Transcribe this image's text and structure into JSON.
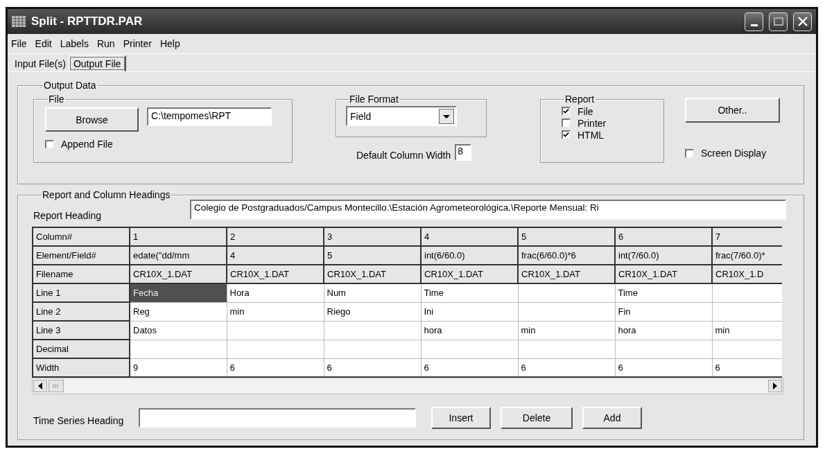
{
  "window": {
    "title": "Split - RPTTDR.PAR"
  },
  "menu": [
    "File",
    "Edit",
    "Labels",
    "Run",
    "Printer",
    "Help"
  ],
  "tabs": [
    {
      "label": "Input File(s)",
      "selected": false
    },
    {
      "label": "Output File",
      "selected": true
    }
  ],
  "output_data": {
    "title": "Output Data",
    "file_group": {
      "title": "File",
      "browse_button": "Browse",
      "path": "C:\\tempomes\\RPT",
      "append_file": {
        "label": "Append File",
        "checked": false
      }
    },
    "file_format": {
      "title": "File Format",
      "value": "Field"
    },
    "default_column_width": {
      "label": "Default Column Width",
      "value": "8"
    },
    "report": {
      "title": "Report",
      "options": [
        {
          "label": "File",
          "checked": true
        },
        {
          "label": "Printer",
          "checked": false
        },
        {
          "label": "HTML",
          "checked": true
        }
      ]
    },
    "other_button": "Other..",
    "screen_display": {
      "label": "Screen Display",
      "checked": false
    }
  },
  "headings": {
    "title": "Report and Column Headings",
    "report_heading": {
      "label": "Report Heading",
      "value": "Colegio de Postgraduados/Campus Montecillo.\\Estación Agrometeorológica.\\Reporte Mensual: Ri"
    },
    "grid": {
      "rows": [
        {
          "label": "Column#",
          "kind": "header",
          "cells": [
            {
              "text": "1",
              "selected": false
            },
            {
              "text": "2",
              "selected": false
            },
            {
              "text": "3",
              "selected": false
            },
            {
              "text": "4",
              "selected": false
            },
            {
              "text": "5",
              "selected": false
            },
            {
              "text": "6",
              "selected": false
            },
            {
              "text": "7",
              "selected": false
            }
          ]
        },
        {
          "label": "Element/Field#",
          "kind": "header",
          "cells": [
            {
              "text": "edate(\"dd/mm",
              "selected": false
            },
            {
              "text": "4",
              "selected": false
            },
            {
              "text": "5",
              "selected": false
            },
            {
              "text": "int(6/60.0)",
              "selected": false
            },
            {
              "text": "frac(6/60.0)*6",
              "selected": false
            },
            {
              "text": "int(7/60.0)",
              "selected": false
            },
            {
              "text": "frac(7/60.0)*",
              "selected": false
            }
          ]
        },
        {
          "label": "Filename",
          "kind": "header",
          "cells": [
            {
              "text": "CR10X_1.DAT",
              "selected": false
            },
            {
              "text": "CR10X_1.DAT",
              "selected": false
            },
            {
              "text": "CR10X_1.DAT",
              "selected": false
            },
            {
              "text": "CR10X_1.DAT",
              "selected": false
            },
            {
              "text": "CR10X_1.DAT",
              "selected": false
            },
            {
              "text": "CR10X_1.DAT",
              "selected": false
            },
            {
              "text": "CR10X_1.D",
              "selected": false
            }
          ]
        },
        {
          "label": "Line 1",
          "kind": "entry",
          "cells": [
            {
              "text": "Fecha",
              "selected": true
            },
            {
              "text": "Hora",
              "selected": false
            },
            {
              "text": "Num",
              "selected": false
            },
            {
              "text": "Time",
              "selected": false
            },
            {
              "selected": false
            },
            {
              "text": "Time",
              "selected": false
            },
            {
              "selected": false
            }
          ]
        },
        {
          "label": "Line 2",
          "kind": "entry",
          "cells": [
            {
              "text": "Reg",
              "selected": false
            },
            {
              "text": "min",
              "selected": false
            },
            {
              "text": "Riego",
              "selected": false
            },
            {
              "text": "Ini",
              "selected": false
            },
            {
              "selected": false
            },
            {
              "text": "Fin",
              "selected": false
            },
            {
              "selected": false
            }
          ]
        },
        {
          "label": "Line 3",
          "kind": "entry",
          "cells": [
            {
              "text": "Datos",
              "selected": false
            },
            {
              "selected": false
            },
            {
              "selected": false
            },
            {
              "text": "hora",
              "selected": false
            },
            {
              "text": "min",
              "selected": false
            },
            {
              "text": "hora",
              "selected": false
            },
            {
              "text": "min",
              "selected": false
            }
          ]
        },
        {
          "label": "Decimal",
          "kind": "entry",
          "cells": [
            {
              "selected": false
            },
            {
              "selected": false
            },
            {
              "selected": false
            },
            {
              "selected": false
            },
            {
              "selected": false
            },
            {
              "selected": false
            },
            {
              "selected": false
            }
          ]
        },
        {
          "label": "Width",
          "kind": "entry",
          "cells": [
            {
              "text": "9",
              "selected": false
            },
            {
              "text": "6",
              "selected": false
            },
            {
              "text": "6",
              "selected": false
            },
            {
              "text": "6",
              "selected": false
            },
            {
              "text": "6",
              "selected": false
            },
            {
              "text": "6",
              "selected": false
            },
            {
              "text": "6",
              "selected": false
            }
          ]
        }
      ]
    },
    "time_series_heading": {
      "label": "Time Series Heading"
    },
    "buttons": [
      "Insert",
      "Delete",
      "Add"
    ]
  }
}
